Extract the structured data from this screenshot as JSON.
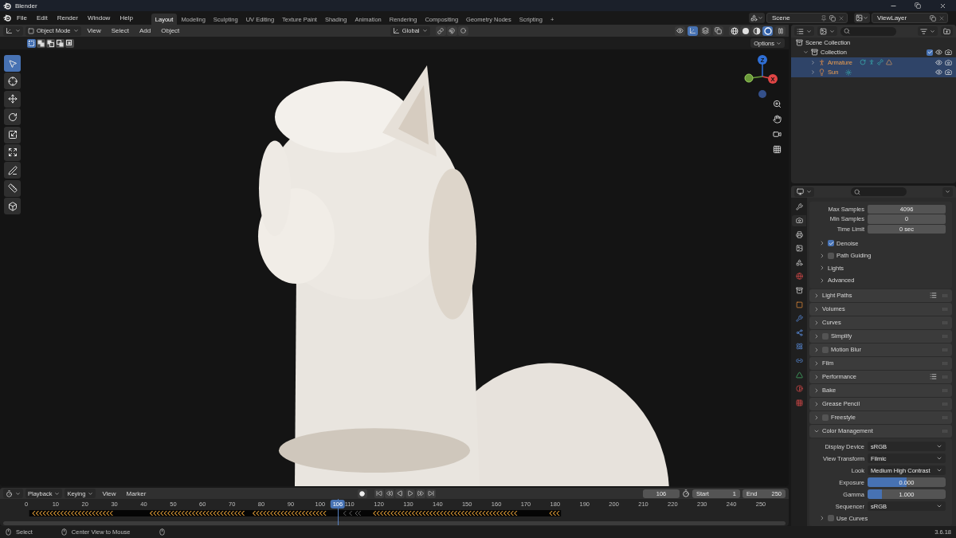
{
  "window": {
    "title": "Blender"
  },
  "menu": [
    "File",
    "Edit",
    "Render",
    "Window",
    "Help"
  ],
  "workspaces": [
    {
      "label": "Layout",
      "selected": true
    },
    {
      "label": "Modeling",
      "selected": false
    },
    {
      "label": "Sculpting",
      "selected": false
    },
    {
      "label": "UV Editing",
      "selected": false
    },
    {
      "label": "Texture Paint",
      "selected": false
    },
    {
      "label": "Shading",
      "selected": false
    },
    {
      "label": "Animation",
      "selected": false
    },
    {
      "label": "Rendering",
      "selected": false
    },
    {
      "label": "Compositing",
      "selected": false
    },
    {
      "label": "Geometry Nodes",
      "selected": false
    },
    {
      "label": "Scripting",
      "selected": false
    }
  ],
  "add_workspace": "+",
  "scene": {
    "value": "Scene"
  },
  "view_layer": {
    "value": "ViewLayer"
  },
  "viewport": {
    "mode": "Object Mode",
    "menus": [
      "View",
      "Select",
      "Add",
      "Object"
    ],
    "orientation": "Global",
    "options": "Options",
    "toggles": [
      {
        "kind": "gizmo",
        "on": true
      },
      {
        "kind": "overlay",
        "on": false
      },
      {
        "kind": "xray",
        "on": false
      }
    ],
    "shading": [
      {
        "kind": "wireframe",
        "selected": false
      },
      {
        "kind": "solid",
        "selected": false
      },
      {
        "kind": "material",
        "selected": false
      },
      {
        "kind": "rendered",
        "selected": true
      }
    ],
    "select_modes": [
      {
        "kind": "set",
        "selected": true
      },
      {
        "kind": "extend",
        "selected": false
      },
      {
        "kind": "subtract",
        "selected": false
      },
      {
        "kind": "invert",
        "selected": false
      },
      {
        "kind": "intersect",
        "selected": false
      }
    ],
    "tools": [
      {
        "kind": "select",
        "selected": true
      },
      {
        "kind": "cursor",
        "selected": false
      },
      {
        "kind": "move",
        "selected": false
      },
      {
        "kind": "rotate",
        "selected": false
      },
      {
        "kind": "scale",
        "selected": false
      },
      {
        "kind": "transform",
        "selected": false
      },
      {
        "kind": "annotate",
        "selected": false
      },
      {
        "kind": "measure",
        "selected": false
      },
      {
        "kind": "add_cube",
        "selected": false
      }
    ],
    "gizmo": [
      {
        "label": "Z",
        "color": "#2f6fd6"
      },
      {
        "label": "X",
        "color": "#e04545"
      }
    ]
  },
  "outliner": {
    "items": [
      {
        "label": "Scene Collection",
        "kind": "scene",
        "selected": false,
        "children": [
          {
            "label": "Collection",
            "kind": "collection",
            "selected": false,
            "expanded": true,
            "checked": true,
            "children": [
              {
                "label": "Armature",
                "kind": "armature",
                "selected": true,
                "expanded": false
              },
              {
                "label": "Sun",
                "kind": "light",
                "selected": true,
                "expanded": false
              }
            ]
          }
        ]
      }
    ]
  },
  "properties": {
    "tabs": [
      {
        "kind": "tool",
        "selected": false
      },
      {
        "kind": "render",
        "selected": true
      },
      {
        "kind": "output",
        "selected": false
      },
      {
        "kind": "view_layer",
        "selected": false
      },
      {
        "kind": "scene",
        "selected": false
      },
      {
        "kind": "world",
        "selected": false
      },
      {
        "kind": "collection",
        "selected": false
      },
      {
        "kind": "object",
        "selected": false
      },
      {
        "kind": "modifiers",
        "selected": false
      },
      {
        "kind": "particles",
        "selected": false
      },
      {
        "kind": "physics",
        "selected": false
      },
      {
        "kind": "constraints",
        "selected": false
      },
      {
        "kind": "data",
        "selected": false
      },
      {
        "kind": "material",
        "selected": false
      },
      {
        "kind": "texture",
        "selected": false
      }
    ],
    "fields": [
      {
        "label": "Max Samples",
        "value": "4096"
      },
      {
        "label": "Min Samples",
        "value": "0"
      },
      {
        "label": "Time Limit",
        "value": "0 sec"
      }
    ],
    "subpanels": [
      {
        "label": "Denoise",
        "kind": "checkbox",
        "checked": true
      },
      {
        "label": "Path Guiding",
        "kind": "checkbox",
        "checked": false
      },
      {
        "label": "Lights",
        "kind": "plain"
      },
      {
        "label": "Advanced",
        "kind": "plain"
      }
    ],
    "panels": [
      {
        "label": "Light Paths",
        "kind": "presets",
        "expanded": false
      },
      {
        "label": "Volumes",
        "kind": "plain",
        "expanded": false
      },
      {
        "label": "Curves",
        "kind": "plain",
        "expanded": false
      },
      {
        "label": "Simplify",
        "kind": "checkbox",
        "checked": false,
        "expanded": false
      },
      {
        "label": "Motion Blur",
        "kind": "checkbox",
        "checked": false,
        "expanded": false
      },
      {
        "label": "Film",
        "kind": "plain",
        "expanded": false
      },
      {
        "label": "Performance",
        "kind": "presets",
        "expanded": false
      },
      {
        "label": "Bake",
        "kind": "plain",
        "expanded": false
      },
      {
        "label": "Grease Pencil",
        "kind": "plain",
        "expanded": false
      },
      {
        "label": "Freestyle",
        "kind": "checkbox",
        "checked": false,
        "expanded": false
      },
      {
        "label": "Color Management",
        "kind": "plain",
        "expanded": true,
        "rows": [
          {
            "label": "Display Device",
            "kind": "dropdown",
            "value": "sRGB"
          },
          {
            "label": "View Transform",
            "kind": "dropdown",
            "value": "Filmic"
          },
          {
            "label": "Look",
            "kind": "dropdown",
            "value": "Medium High Contrast"
          },
          {
            "label": "Exposure",
            "kind": "slider",
            "value": "0.000",
            "level": 0.5
          },
          {
            "label": "Gamma",
            "kind": "slider",
            "value": "1.000",
            "level": 0.18
          },
          {
            "label": "Sequencer",
            "kind": "dropdown",
            "value": "sRGB"
          }
        ],
        "subpanels": [
          {
            "label": "Use Curves",
            "kind": "checkbox",
            "checked": false
          }
        ]
      }
    ]
  },
  "timeline": {
    "menus": [
      "Playback",
      "Keying",
      "View",
      "Marker"
    ],
    "frame": "106",
    "start_label": "Start",
    "start": "1",
    "end_label": "End",
    "end": "250",
    "ticks": [
      "0",
      "10",
      "20",
      "30",
      "40",
      "50",
      "60",
      "70",
      "80",
      "90",
      "100",
      "110",
      "120",
      "130",
      "140",
      "150",
      "160",
      "170",
      "180",
      "190",
      "200",
      "210",
      "220",
      "230",
      "240",
      "250"
    ],
    "current": "106",
    "level": 0.424
  },
  "status": {
    "items": [
      "Select",
      "Center View to Mouse"
    ],
    "version": "3.6.18"
  }
}
